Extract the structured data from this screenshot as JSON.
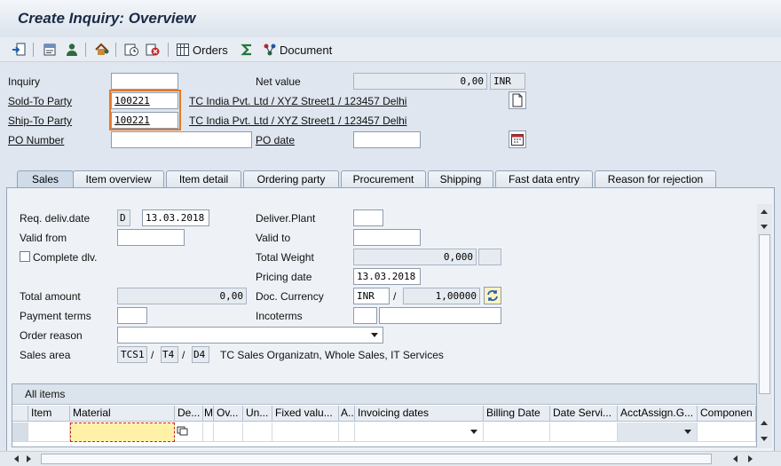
{
  "title": "Create Inquiry: Overview",
  "toolbar": {
    "orders_label": "Orders",
    "document_label": "Document"
  },
  "header": {
    "inquiry": {
      "label": "Inquiry",
      "value": ""
    },
    "net_value": {
      "label": "Net value",
      "value": "0,00",
      "currency": "INR"
    },
    "sold_to": {
      "label": "Sold-To Party",
      "value": "100221",
      "description": "TC India Pvt. Ltd / XYZ Street1 / 123457 Delhi"
    },
    "ship_to": {
      "label": "Ship-To Party",
      "value": "100221",
      "description": "TC India Pvt. Ltd / XYZ Street1 / 123457 Delhi"
    },
    "po_number": {
      "label": "PO Number",
      "value": ""
    },
    "po_date": {
      "label": "PO date",
      "value": ""
    }
  },
  "tabs": [
    "Sales",
    "Item overview",
    "Item detail",
    "Ordering party",
    "Procurement",
    "Shipping",
    "Fast data entry",
    "Reason for rejection"
  ],
  "sales": {
    "req_deliv_date": {
      "label": "Req. deliv.date",
      "type": "D",
      "value": "13.03.2018"
    },
    "deliver_plant": {
      "label": "Deliver.Plant",
      "value": ""
    },
    "valid_from": {
      "label": "Valid from",
      "value": ""
    },
    "valid_to": {
      "label": "Valid to",
      "value": ""
    },
    "complete_dlv": {
      "label": "Complete dlv.",
      "checked": false
    },
    "total_weight": {
      "label": "Total Weight",
      "value": "0,000",
      "unit": ""
    },
    "pricing_date": {
      "label": "Pricing date",
      "value": "13.03.2018"
    },
    "total_amount": {
      "label": "Total amount",
      "value": "0,00"
    },
    "doc_currency": {
      "label": "Doc. Currency",
      "value": "INR",
      "rate": "1,00000"
    },
    "payment_terms": {
      "label": "Payment terms",
      "value": ""
    },
    "incoterms": {
      "label": "Incoterms",
      "value": "",
      "value2": ""
    },
    "order_reason": {
      "label": "Order reason",
      "value": ""
    },
    "sales_area": {
      "label": "Sales area",
      "org": "TCS1",
      "channel": "T4",
      "division": "D4",
      "description": "TC Sales Organizatn, Whole Sales, IT Services",
      "sep": "/"
    }
  },
  "items_table": {
    "title": "All items",
    "columns": [
      "Item",
      "Material",
      "De...",
      "M",
      "Ov...",
      "Un...",
      "Fixed valu...",
      "A..",
      "Invoicing dates",
      "Billing Date",
      "Date Servi...",
      "AcctAssign.G...",
      "Componen"
    ]
  },
  "colors": {
    "highlight_border": "#e87722",
    "active_cell": "#fff2a8"
  }
}
